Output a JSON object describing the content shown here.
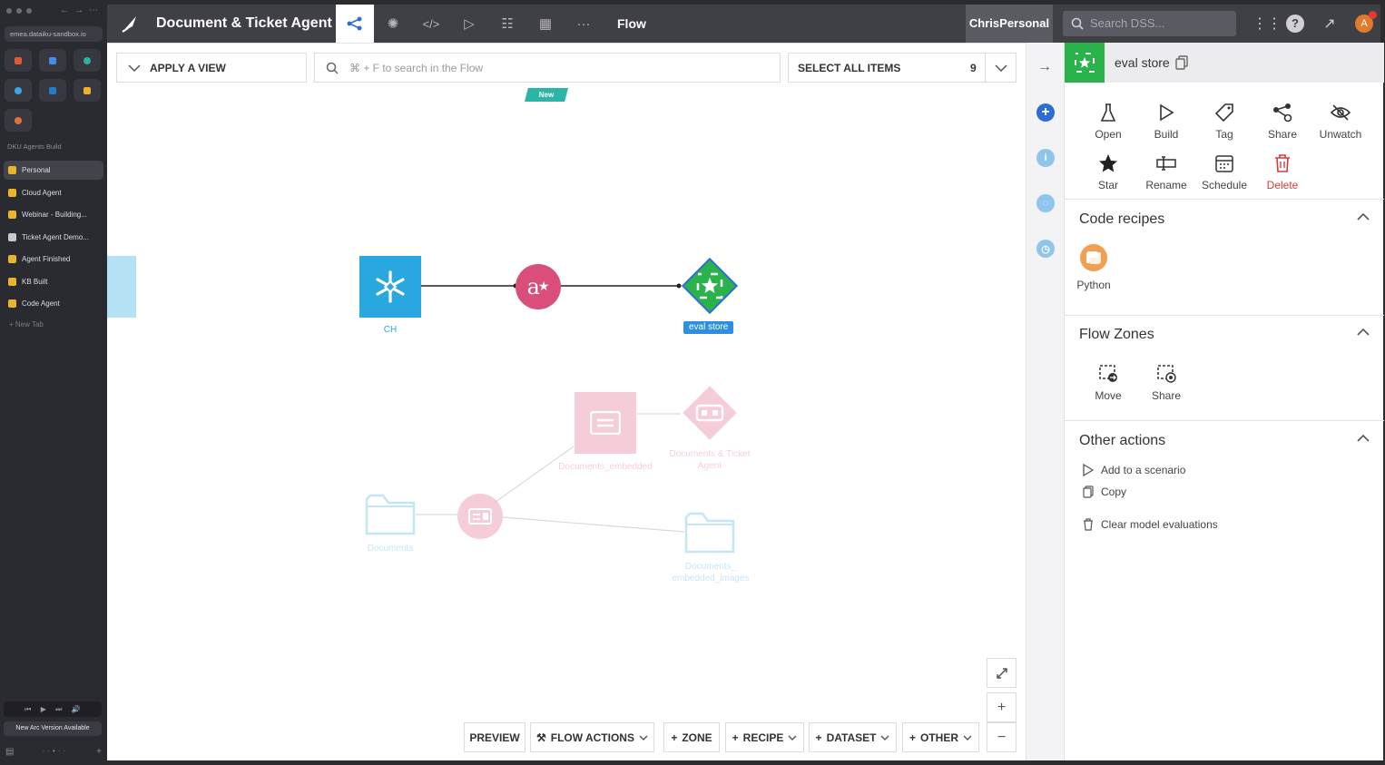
{
  "browser": {
    "url": "emea.dataiku-sandbox.io",
    "section_title": "DKU Agents Build",
    "tabs": [
      {
        "label": "Personal"
      },
      {
        "label": "Cloud Agent"
      },
      {
        "label": "Webinar - Building..."
      },
      {
        "label": "Ticket Agent Demo..."
      },
      {
        "label": "Agent Finished"
      },
      {
        "label": "KB Built"
      },
      {
        "label": "Code Agent"
      }
    ],
    "new_tab": "+ New Tab",
    "update_notice": "New Arc Version Available"
  },
  "topbar": {
    "project_name": "Document & Ticket Agent",
    "current_view": "Flow",
    "user_space": "ChrisPersonal",
    "search_placeholder": "Search DSS...",
    "avatar_letter": "A"
  },
  "flow": {
    "apply_view": "APPLY A VIEW",
    "search_placeholder": "⌘ + F to search in the Flow",
    "select_all": "SELECT ALL ITEMS",
    "item_count": "9",
    "new_badge": "New",
    "nodes": {
      "ch": "CH",
      "eval_store": "eval store",
      "documents_embedded": "Documents_embedded",
      "documents_ticket_agent": "Documents & Ticket Agent",
      "documents": "Documents",
      "documents_embedded_images": "Documents_ embedded_images"
    },
    "bottom_actions": {
      "preview": "PREVIEW",
      "flow_actions": "FLOW ACTIONS",
      "zone": "ZONE",
      "recipe": "RECIPE",
      "dataset": "DATASET",
      "other": "OTHER"
    }
  },
  "panel": {
    "title": "eval store",
    "actions": [
      {
        "label": "Open",
        "icon": "flask-icon"
      },
      {
        "label": "Build",
        "icon": "play-icon"
      },
      {
        "label": "Tag",
        "icon": "tag-icon"
      },
      {
        "label": "Share",
        "icon": "share-icon"
      },
      {
        "label": "Unwatch",
        "icon": "eye-off-icon"
      },
      {
        "label": "Star",
        "icon": "star-icon"
      },
      {
        "label": "Rename",
        "icon": "rename-icon"
      },
      {
        "label": "Schedule",
        "icon": "calendar-icon"
      },
      {
        "label": "Delete",
        "icon": "trash-icon"
      }
    ],
    "code_recipes_title": "Code recipes",
    "python_label": "Python",
    "flow_zones_title": "Flow Zones",
    "zone_move": "Move",
    "zone_share": "Share",
    "other_actions_title": "Other actions",
    "add_to_scenario": "Add to a scenario",
    "copy": "Copy",
    "clear_evaluations": "Clear model evaluations"
  },
  "colors": {
    "accent_blue": "#2d6ed6",
    "snowflake_blue": "#29a8e0",
    "recipe_pink": "#d94f7a",
    "eval_green": "#2ab34b",
    "danger": "#d63b3b"
  }
}
